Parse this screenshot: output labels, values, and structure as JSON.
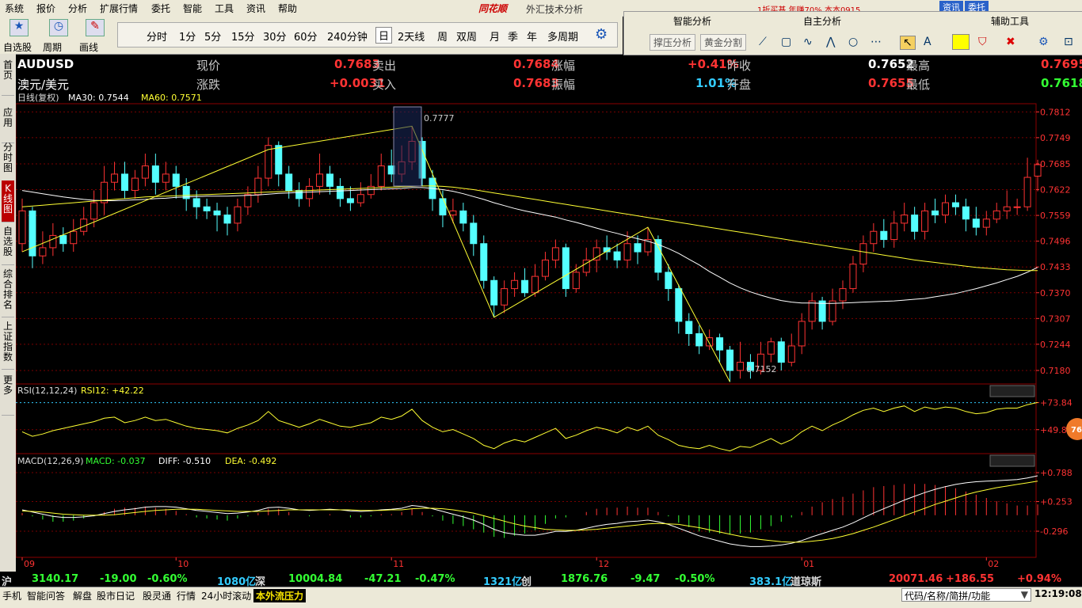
{
  "menu": {
    "items": [
      "系统",
      "报价",
      "分析",
      "扩展行情",
      "委托",
      "智能",
      "工具",
      "资讯",
      "帮助"
    ],
    "brand": "同花顺",
    "title": "外汇技术分析",
    "ad": "1折买基 年赚70% 本本0915",
    "top_btns": [
      "资讯",
      "委托"
    ]
  },
  "toolbar": {
    "buttons": [
      "自选股",
      "周期",
      "画线"
    ],
    "periods": [
      "分时",
      "1分",
      "5分",
      "15分",
      "30分",
      "60分",
      "240分钟",
      "日",
      "2天线",
      "周",
      "双周",
      "月",
      "季",
      "年",
      "多周期"
    ],
    "active_period": "日"
  },
  "rpanel": {
    "smart": "智能分析",
    "own": "自主分析",
    "aux": "辅助工具",
    "btn1": "撑压分析",
    "btn2": "黄金分割"
  },
  "left_tabs": [
    "首页",
    "应用",
    "分时图",
    "K线图",
    "自选股",
    "综合排名",
    "上证指数",
    "更多"
  ],
  "quote": {
    "symbol": "AUDUSD",
    "name": "澳元/美元",
    "r1": [
      {
        "l": "现价",
        "v": "0.7683"
      },
      {
        "l": "卖出",
        "v": "0.7684"
      },
      {
        "l": "涨幅",
        "v": "+0.41%"
      },
      {
        "l": "昨收",
        "v": "0.7652"
      },
      {
        "l": "最高",
        "v": "0.7695"
      }
    ],
    "r2": [
      {
        "l": "涨跌",
        "v": "+0.0031"
      },
      {
        "l": "买入",
        "v": "0.7683"
      },
      {
        "l": "振幅",
        "v": "1.01%"
      },
      {
        "l": "开盘",
        "v": "0.7655"
      },
      {
        "l": "最低",
        "v": "0.7618"
      }
    ]
  },
  "chart_data": {
    "type": "candlestick",
    "main_header": {
      "label": "日线(复权)",
      "ma30": "MA30: 0.7544",
      "ma60": "MA60: 0.7571"
    },
    "price_ticks": [
      "0.7812",
      "0.7749",
      "0.7685",
      "0.7622",
      "0.7559",
      "0.7496",
      "0.7433",
      "0.7370",
      "0.7307",
      "0.7244",
      "0.7180"
    ],
    "price_range": [
      0.7147,
      0.7832
    ],
    "high_label": "0.7777",
    "low_label": "0.7152",
    "x_labels": [
      "09",
      "10",
      "11",
      "12",
      "01",
      "02"
    ],
    "x_label_index": [
      0,
      15,
      36,
      56,
      76,
      94
    ],
    "candles": [
      [
        0.749,
        0.757,
        0.76,
        0.747
      ],
      [
        0.757,
        0.746,
        0.758,
        0.743
      ],
      [
        0.746,
        0.748,
        0.752,
        0.744
      ],
      [
        0.748,
        0.751,
        0.754,
        0.746
      ],
      [
        0.751,
        0.749,
        0.753,
        0.747
      ],
      [
        0.749,
        0.752,
        0.755,
        0.747
      ],
      [
        0.752,
        0.755,
        0.758,
        0.751
      ],
      [
        0.755,
        0.759,
        0.762,
        0.753
      ],
      [
        0.759,
        0.764,
        0.768,
        0.756
      ],
      [
        0.764,
        0.766,
        0.769,
        0.762
      ],
      [
        0.766,
        0.762,
        0.769,
        0.76
      ],
      [
        0.762,
        0.765,
        0.767,
        0.76
      ],
      [
        0.765,
        0.768,
        0.771,
        0.763
      ],
      [
        0.768,
        0.764,
        0.771,
        0.761
      ],
      [
        0.764,
        0.766,
        0.769,
        0.762
      ],
      [
        0.766,
        0.763,
        0.768,
        0.76
      ],
      [
        0.763,
        0.76,
        0.765,
        0.757
      ],
      [
        0.76,
        0.758,
        0.762,
        0.755
      ],
      [
        0.758,
        0.757,
        0.76,
        0.755
      ],
      [
        0.757,
        0.756,
        0.759,
        0.752
      ],
      [
        0.756,
        0.754,
        0.758,
        0.751
      ],
      [
        0.754,
        0.758,
        0.76,
        0.752
      ],
      [
        0.758,
        0.761,
        0.763,
        0.756
      ],
      [
        0.761,
        0.765,
        0.768,
        0.759
      ],
      [
        0.765,
        0.773,
        0.775,
        0.763
      ],
      [
        0.773,
        0.766,
        0.774,
        0.763
      ],
      [
        0.766,
        0.762,
        0.768,
        0.76
      ],
      [
        0.762,
        0.76,
        0.764,
        0.758
      ],
      [
        0.76,
        0.763,
        0.765,
        0.758
      ],
      [
        0.763,
        0.766,
        0.771,
        0.761
      ],
      [
        0.766,
        0.763,
        0.768,
        0.761
      ],
      [
        0.763,
        0.76,
        0.765,
        0.758
      ],
      [
        0.76,
        0.759,
        0.763,
        0.757
      ],
      [
        0.759,
        0.761,
        0.764,
        0.758
      ],
      [
        0.761,
        0.763,
        0.766,
        0.76
      ],
      [
        0.763,
        0.768,
        0.771,
        0.762
      ],
      [
        0.768,
        0.766,
        0.772,
        0.764
      ],
      [
        0.766,
        0.769,
        0.773,
        0.764
      ],
      [
        0.769,
        0.774,
        0.7777,
        0.767
      ],
      [
        0.774,
        0.765,
        0.775,
        0.763
      ],
      [
        0.765,
        0.76,
        0.767,
        0.757
      ],
      [
        0.76,
        0.756,
        0.762,
        0.753
      ],
      [
        0.756,
        0.757,
        0.76,
        0.754
      ],
      [
        0.757,
        0.754,
        0.759,
        0.752
      ],
      [
        0.754,
        0.749,
        0.756,
        0.746
      ],
      [
        0.749,
        0.74,
        0.751,
        0.738
      ],
      [
        0.74,
        0.734,
        0.741,
        0.731
      ],
      [
        0.734,
        0.738,
        0.74,
        0.732
      ],
      [
        0.738,
        0.74,
        0.742,
        0.736
      ],
      [
        0.74,
        0.737,
        0.743,
        0.736
      ],
      [
        0.737,
        0.741,
        0.744,
        0.736
      ],
      [
        0.741,
        0.745,
        0.747,
        0.74
      ],
      [
        0.745,
        0.748,
        0.75,
        0.743
      ],
      [
        0.748,
        0.738,
        0.749,
        0.736
      ],
      [
        0.738,
        0.742,
        0.744,
        0.737
      ],
      [
        0.742,
        0.745,
        0.748,
        0.741
      ],
      [
        0.745,
        0.748,
        0.75,
        0.742
      ],
      [
        0.748,
        0.747,
        0.751,
        0.745
      ],
      [
        0.747,
        0.745,
        0.749,
        0.743
      ],
      [
        0.745,
        0.749,
        0.752,
        0.743
      ],
      [
        0.749,
        0.747,
        0.751,
        0.744
      ],
      [
        0.747,
        0.75,
        0.753,
        0.746
      ],
      [
        0.75,
        0.742,
        0.751,
        0.74
      ],
      [
        0.742,
        0.738,
        0.744,
        0.735
      ],
      [
        0.738,
        0.73,
        0.739,
        0.727
      ],
      [
        0.73,
        0.727,
        0.732,
        0.724
      ],
      [
        0.727,
        0.724,
        0.729,
        0.722
      ],
      [
        0.724,
        0.726,
        0.728,
        0.723
      ],
      [
        0.726,
        0.723,
        0.727,
        0.72
      ],
      [
        0.723,
        0.718,
        0.724,
        0.7152
      ],
      [
        0.718,
        0.72,
        0.725,
        0.716
      ],
      [
        0.72,
        0.718,
        0.722,
        0.716
      ],
      [
        0.718,
        0.722,
        0.725,
        0.717
      ],
      [
        0.722,
        0.725,
        0.726,
        0.72
      ],
      [
        0.725,
        0.72,
        0.726,
        0.718
      ],
      [
        0.72,
        0.724,
        0.727,
        0.719
      ],
      [
        0.724,
        0.73,
        0.732,
        0.722
      ],
      [
        0.73,
        0.735,
        0.737,
        0.728
      ],
      [
        0.735,
        0.73,
        0.736,
        0.728
      ],
      [
        0.73,
        0.735,
        0.738,
        0.729
      ],
      [
        0.735,
        0.738,
        0.74,
        0.733
      ],
      [
        0.738,
        0.744,
        0.746,
        0.737
      ],
      [
        0.744,
        0.749,
        0.751,
        0.742
      ],
      [
        0.749,
        0.752,
        0.754,
        0.747
      ],
      [
        0.752,
        0.75,
        0.755,
        0.748
      ],
      [
        0.75,
        0.754,
        0.757,
        0.748
      ],
      [
        0.754,
        0.756,
        0.759,
        0.752
      ],
      [
        0.756,
        0.752,
        0.758,
        0.75
      ],
      [
        0.752,
        0.757,
        0.759,
        0.75
      ],
      [
        0.757,
        0.756,
        0.76,
        0.754
      ],
      [
        0.756,
        0.759,
        0.761,
        0.754
      ],
      [
        0.759,
        0.758,
        0.761,
        0.756
      ],
      [
        0.758,
        0.755,
        0.76,
        0.752
      ],
      [
        0.755,
        0.753,
        0.758,
        0.751
      ],
      [
        0.753,
        0.755,
        0.757,
        0.751
      ],
      [
        0.755,
        0.757,
        0.759,
        0.754
      ],
      [
        0.757,
        0.758,
        0.762,
        0.755
      ],
      [
        0.758,
        0.758,
        0.76,
        0.756
      ],
      [
        0.758,
        0.7652,
        0.77,
        0.757
      ],
      [
        0.7655,
        0.7683,
        0.7695,
        0.7618
      ]
    ],
    "ma30": [
      0.762,
      0.7616,
      0.7612,
      0.7608,
      0.7604,
      0.7601,
      0.7598,
      0.7596,
      0.7595,
      0.7595,
      0.7596,
      0.7597,
      0.7598,
      0.76,
      0.7601,
      0.7603,
      0.7604,
      0.7605,
      0.7606,
      0.7606,
      0.7606,
      0.7607,
      0.7608,
      0.7609,
      0.7611,
      0.7613,
      0.7614,
      0.7615,
      0.7616,
      0.7617,
      0.7618,
      0.7619,
      0.762,
      0.7621,
      0.7622,
      0.7623,
      0.7624,
      0.7625,
      0.7627,
      0.7627,
      0.7625,
      0.7622,
      0.7618,
      0.7612,
      0.7605,
      0.7598,
      0.759,
      0.7583,
      0.7576,
      0.757,
      0.7565,
      0.756,
      0.7555,
      0.7548,
      0.7542,
      0.7535,
      0.7528,
      0.7521,
      0.7515,
      0.7508,
      0.7502,
      0.7496,
      0.7488,
      0.7478,
      0.7466,
      0.7452,
      0.7438,
      0.7422,
      0.7408,
      0.7394,
      0.7382,
      0.7372,
      0.7364,
      0.7357,
      0.7351,
      0.7347,
      0.7345,
      0.7345,
      0.7344,
      0.7344,
      0.7345,
      0.7346,
      0.7347,
      0.7348,
      0.7349,
      0.735,
      0.7352,
      0.7354,
      0.7356,
      0.736,
      0.7364,
      0.7368,
      0.7374,
      0.738,
      0.7387,
      0.7394,
      0.7402,
      0.741,
      0.742,
      0.7432
    ],
    "ma60": [
      0.758,
      0.7582,
      0.7584,
      0.7586,
      0.7588,
      0.759,
      0.7592,
      0.7594,
      0.7596,
      0.7598,
      0.76,
      0.7602,
      0.7604,
      0.7605,
      0.7606,
      0.7607,
      0.7608,
      0.7609,
      0.761,
      0.7611,
      0.7612,
      0.7613,
      0.7614,
      0.7615,
      0.7616,
      0.7617,
      0.7618,
      0.7619,
      0.762,
      0.7621,
      0.7622,
      0.7623,
      0.7624,
      0.7625,
      0.7626,
      0.7627,
      0.7628,
      0.7629,
      0.763,
      0.7631,
      0.7631,
      0.763,
      0.7628,
      0.7625,
      0.7622,
      0.7618,
      0.7614,
      0.761,
      0.7606,
      0.7602,
      0.7598,
      0.7594,
      0.759,
      0.7586,
      0.7582,
      0.7578,
      0.7574,
      0.757,
      0.7566,
      0.7562,
      0.7558,
      0.7554,
      0.755,
      0.7546,
      0.7542,
      0.7538,
      0.7534,
      0.753,
      0.7526,
      0.7522,
      0.7518,
      0.7514,
      0.751,
      0.7506,
      0.7502,
      0.7498,
      0.7494,
      0.749,
      0.7486,
      0.7482,
      0.7478,
      0.7474,
      0.747,
      0.7466,
      0.7462,
      0.7458,
      0.7454,
      0.745,
      0.7447,
      0.7444,
      0.7441,
      0.7438,
      0.7435,
      0.7432,
      0.743,
      0.7428,
      0.7426,
      0.7425,
      0.7424,
      0.7424
    ],
    "zigzag": [
      [
        0,
        0.747
      ],
      [
        24,
        0.772
      ],
      [
        38,
        0.7777
      ],
      [
        46,
        0.731
      ],
      [
        61,
        0.753
      ],
      [
        69,
        0.7152
      ]
    ],
    "rsi_header": {
      "label": "RSI(12,12,24)",
      "value": "RSI12: +42.22"
    },
    "rsi_ticks": [
      "+73.84",
      "+49.85"
    ],
    "rsi_range": [
      30,
      82
    ],
    "rsi": [
      48,
      44,
      46,
      49,
      51,
      53,
      55,
      57,
      60,
      61,
      56,
      58,
      61,
      58,
      59,
      56,
      53,
      51,
      50,
      49,
      47,
      51,
      54,
      58,
      66,
      58,
      55,
      52,
      55,
      59,
      56,
      53,
      52,
      54,
      56,
      61,
      59,
      62,
      68,
      58,
      52,
      48,
      50,
      46,
      42,
      36,
      33,
      38,
      41,
      39,
      43,
      47,
      51,
      42,
      45,
      49,
      52,
      50,
      47,
      52,
      49,
      53,
      45,
      41,
      36,
      34,
      33,
      36,
      33,
      31,
      35,
      34,
      38,
      42,
      37,
      41,
      48,
      53,
      49,
      54,
      58,
      63,
      67,
      69,
      66,
      69,
      71,
      66,
      70,
      68,
      70,
      69,
      66,
      64,
      65,
      68,
      69,
      69,
      72,
      74
    ],
    "macd_header": {
      "label": "MACD(12,26,9)",
      "macd": "MACD: -0.037",
      "diff": "DIFF: -0.510",
      "dea": "DEA: -0.492"
    },
    "macd_ticks": [
      "+0.788",
      "+0.253",
      "-0.296"
    ],
    "macd_range": [
      -0.75,
      0.95
    ],
    "diff": [
      0.1,
      0.06,
      0.02,
      -0.02,
      -0.04,
      -0.04,
      -0.03,
      -0.01,
      0.03,
      0.07,
      0.1,
      0.12,
      0.15,
      0.16,
      0.16,
      0.15,
      0.12,
      0.09,
      0.07,
      0.05,
      0.03,
      0.04,
      0.06,
      0.09,
      0.14,
      0.15,
      0.13,
      0.1,
      0.09,
      0.1,
      0.11,
      0.1,
      0.08,
      0.07,
      0.08,
      0.1,
      0.11,
      0.13,
      0.18,
      0.16,
      0.12,
      0.07,
      0.02,
      -0.03,
      -0.09,
      -0.17,
      -0.26,
      -0.32,
      -0.35,
      -0.37,
      -0.37,
      -0.34,
      -0.3,
      -0.3,
      -0.28,
      -0.24,
      -0.2,
      -0.17,
      -0.15,
      -0.12,
      -0.11,
      -0.09,
      -0.12,
      -0.17,
      -0.24,
      -0.31,
      -0.38,
      -0.43,
      -0.48,
      -0.53,
      -0.56,
      -0.58,
      -0.58,
      -0.57,
      -0.55,
      -0.52,
      -0.47,
      -0.4,
      -0.34,
      -0.28,
      -0.22,
      -0.14,
      -0.05,
      0.04,
      0.12,
      0.2,
      0.28,
      0.35,
      0.42,
      0.48,
      0.53,
      0.57,
      0.6,
      0.62,
      0.63,
      0.64,
      0.65,
      0.66,
      0.69,
      0.73
    ],
    "dea": [
      0.08,
      0.07,
      0.06,
      0.04,
      0.02,
      0.01,
      0.0,
      0.0,
      0.0,
      0.01,
      0.03,
      0.05,
      0.07,
      0.09,
      0.1,
      0.11,
      0.11,
      0.11,
      0.1,
      0.09,
      0.08,
      0.07,
      0.07,
      0.07,
      0.08,
      0.09,
      0.1,
      0.1,
      0.1,
      0.1,
      0.1,
      0.1,
      0.1,
      0.09,
      0.09,
      0.09,
      0.1,
      0.1,
      0.12,
      0.13,
      0.13,
      0.12,
      0.1,
      0.07,
      0.04,
      -0.01,
      -0.06,
      -0.11,
      -0.16,
      -0.2,
      -0.23,
      -0.26,
      -0.27,
      -0.28,
      -0.28,
      -0.27,
      -0.26,
      -0.24,
      -0.22,
      -0.2,
      -0.18,
      -0.16,
      -0.15,
      -0.16,
      -0.17,
      -0.2,
      -0.23,
      -0.27,
      -0.31,
      -0.35,
      -0.39,
      -0.42,
      -0.45,
      -0.47,
      -0.49,
      -0.5,
      -0.5,
      -0.48,
      -0.46,
      -0.43,
      -0.39,
      -0.34,
      -0.28,
      -0.22,
      -0.15,
      -0.08,
      -0.01,
      0.06,
      0.13,
      0.2,
      0.26,
      0.32,
      0.38,
      0.43,
      0.47,
      0.51,
      0.54,
      0.57,
      0.6,
      0.63
    ]
  },
  "status": {
    "sh_label": "沪",
    "sh": "3140.17",
    "sh_chg": "-19.00",
    "sh_pct": "-0.60%",
    "sh_amt": "1080亿",
    "sz_label": "深",
    "sz": "10004.84",
    "sz_chg": "-47.21",
    "sz_pct": "-0.47%",
    "sz_amt": "1321亿",
    "cy_label": "创",
    "cy": "1876.76",
    "cy_chg": "-9.47",
    "cy_pct": "-0.50%",
    "cy_amt": "383.1亿",
    "dj_label": "道琼斯",
    "dj": "20071.46",
    "dj_chg": "+186.55",
    "dj_pct": "+0.94%"
  },
  "bottom": {
    "items": [
      "手机",
      "智能问答",
      "解盘",
      "股市日记",
      "股灵通",
      "行情",
      "24小时滚动"
    ],
    "ticker": "本外流压力",
    "search_placeholder": "代码/名称/简拼/功能",
    "time": "12:19:08"
  },
  "colors": {
    "up": "#ff3333",
    "down": "#54ffff",
    "ma30": "#ffffff",
    "ma60": "#ffff33",
    "grid": "#7a0000",
    "label_red": "#ff3333",
    "label_green": "#33ff33",
    "label_cyan": "#33ccff"
  },
  "badge": "76"
}
